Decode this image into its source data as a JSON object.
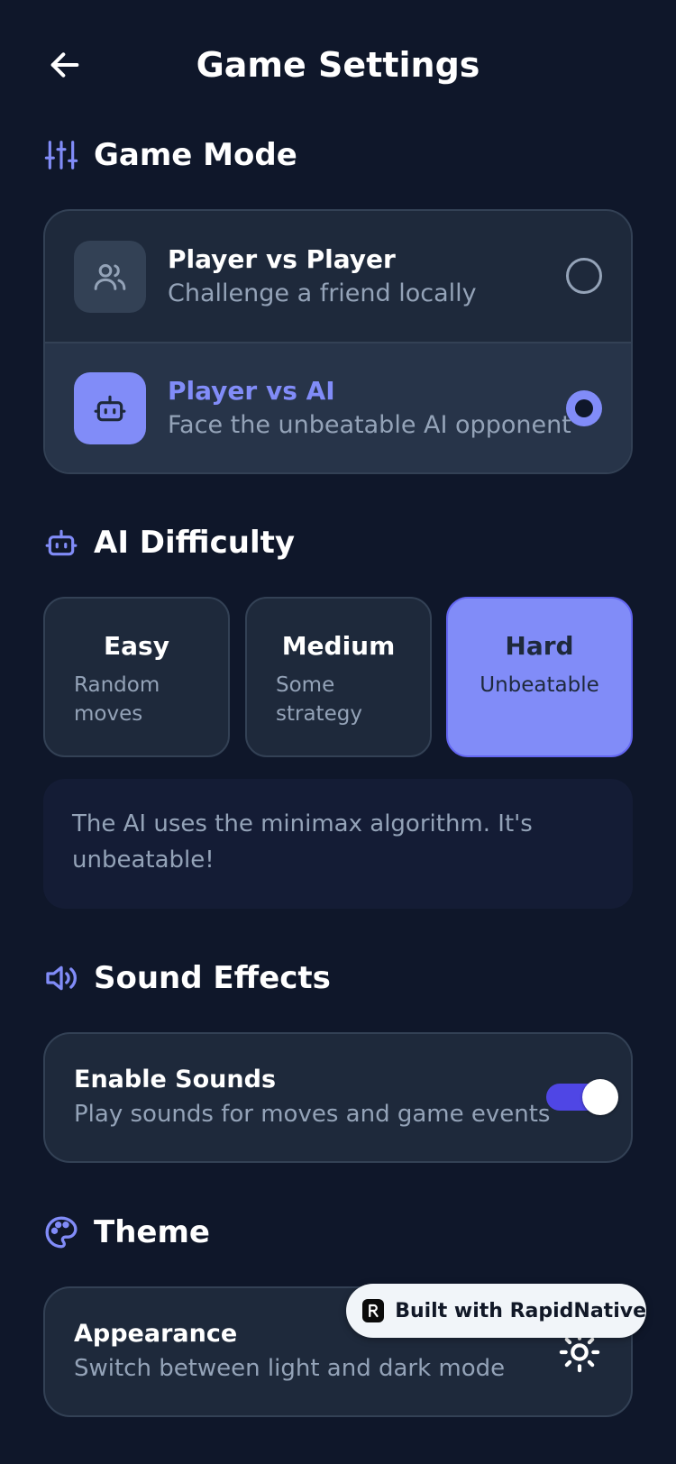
{
  "header": {
    "title": "Game Settings"
  },
  "game_mode": {
    "title": "Game Mode",
    "options": [
      {
        "title": "Player vs Player",
        "subtitle": "Challenge a friend locally",
        "selected": false
      },
      {
        "title": "Player vs AI",
        "subtitle": "Face the unbeatable AI opponent",
        "selected": true
      }
    ]
  },
  "ai_difficulty": {
    "title": "AI Difficulty",
    "options": [
      {
        "title": "Easy",
        "subtitle": "Random moves",
        "selected": false
      },
      {
        "title": "Medium",
        "subtitle": "Some strategy",
        "selected": false
      },
      {
        "title": "Hard",
        "subtitle": "Unbeatable",
        "selected": true
      }
    ],
    "info": "The AI uses the minimax algorithm. It's unbeatable!"
  },
  "sound_effects": {
    "title": "Sound Effects",
    "enable_title": "Enable Sounds",
    "enable_subtitle": "Play sounds for moves and game events",
    "enabled": true
  },
  "theme": {
    "title": "Theme",
    "appearance_title": "Appearance",
    "appearance_subtitle": "Switch between light and dark mode"
  },
  "badge": {
    "text": "Built with RapidNative"
  },
  "colors": {
    "background": "#0f172a",
    "card": "#1e293b",
    "card_border": "#334155",
    "accent": "#818cf8",
    "toggle_track": "#4f46e5",
    "muted_text": "#94a3b8"
  },
  "icons": {
    "back": "arrow-left-icon",
    "game_mode": "sliders-icon",
    "pvp": "users-icon",
    "pva": "robot-icon",
    "ai_difficulty": "robot-icon",
    "sound": "speaker-icon",
    "theme": "palette-icon",
    "appearance": "sun-icon"
  }
}
